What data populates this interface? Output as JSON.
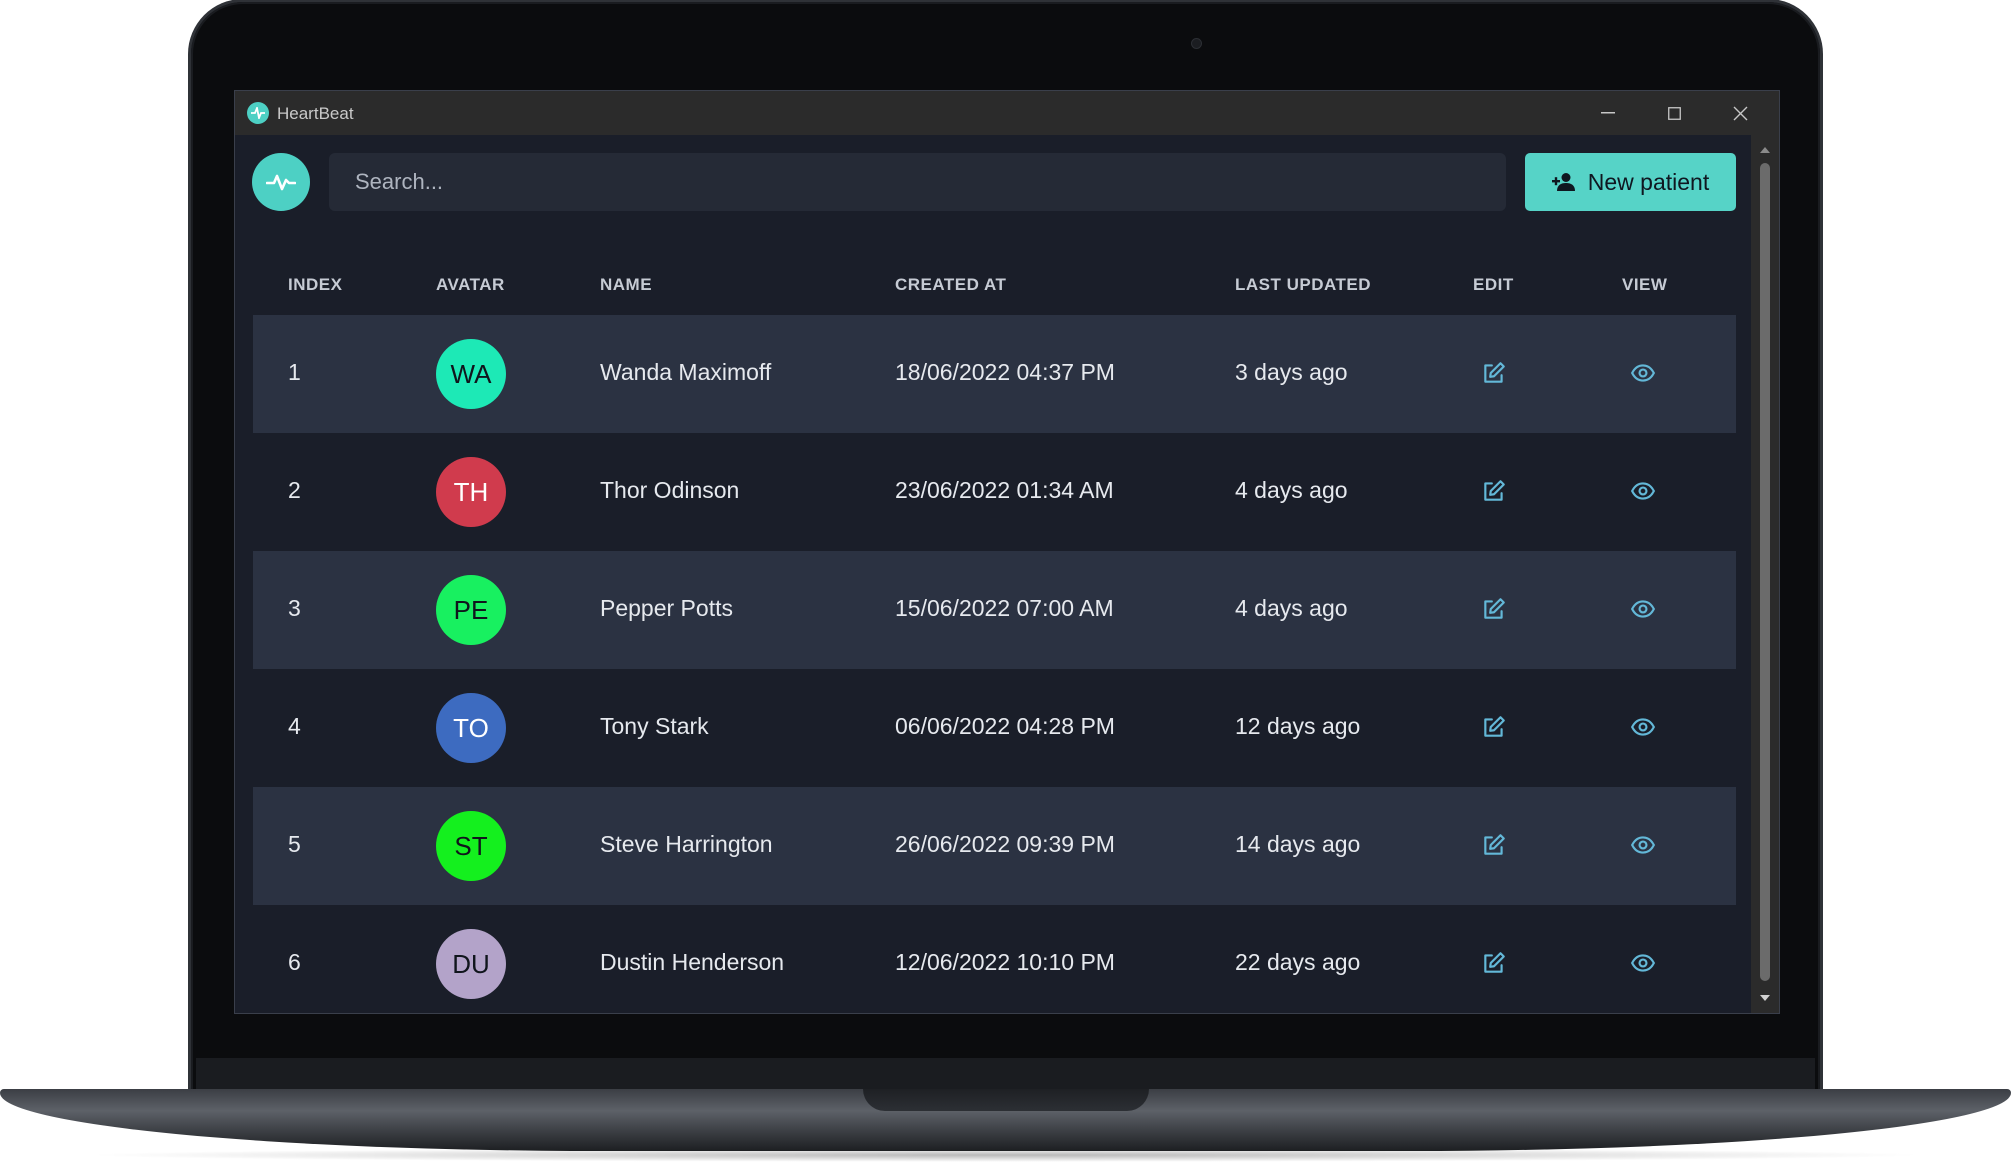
{
  "window": {
    "title": "HeartBeat",
    "minimize_glyph": "—",
    "maximize_glyph": "☐",
    "close_glyph": "✕"
  },
  "search": {
    "placeholder": "Search..."
  },
  "new_patient_button": {
    "label": "New patient",
    "icon": "user-plus-icon"
  },
  "logo": {
    "icon": "heartbeat-pulse-icon"
  },
  "table": {
    "headers": {
      "index": "INDEX",
      "avatar": "AVATAR",
      "name": "NAME",
      "created_at": "CREATED AT",
      "last_updated": "LAST UPDATED",
      "edit": "EDIT",
      "view": "VIEW"
    },
    "rows": [
      {
        "index": "1",
        "initials": "WA",
        "name": "Wanda Maximoff",
        "created_at": "18/06/2022 04:37 PM",
        "last_updated": "3 days ago",
        "avatar_color": "#1de9b6"
      },
      {
        "index": "2",
        "initials": "TH",
        "name": "Thor Odinson",
        "created_at": "23/06/2022 01:34 AM",
        "last_updated": "4 days ago",
        "avatar_color": "#d03b4d"
      },
      {
        "index": "3",
        "initials": "PE",
        "name": "Pepper Potts",
        "created_at": "15/06/2022 07:00 AM",
        "last_updated": "4 days ago",
        "avatar_color": "#18f060"
      },
      {
        "index": "4",
        "initials": "TO",
        "name": "Tony Stark",
        "created_at": "06/06/2022 04:28 PM",
        "last_updated": "12 days ago",
        "avatar_color": "#3d6bc0"
      },
      {
        "index": "5",
        "initials": "ST",
        "name": "Steve Harrington",
        "created_at": "26/06/2022 09:39 PM",
        "last_updated": "14 days ago",
        "avatar_color": "#14f01e"
      },
      {
        "index": "6",
        "initials": "DU",
        "name": "Dustin Henderson",
        "created_at": "12/06/2022 10:10 PM",
        "last_updated": "22 days ago",
        "avatar_color": "#b3a3c9"
      }
    ]
  },
  "colors": {
    "accent": "#56d3c7",
    "background": "#1a1e29",
    "row_alt": "#2b3242",
    "icon": "#63b8d8"
  }
}
